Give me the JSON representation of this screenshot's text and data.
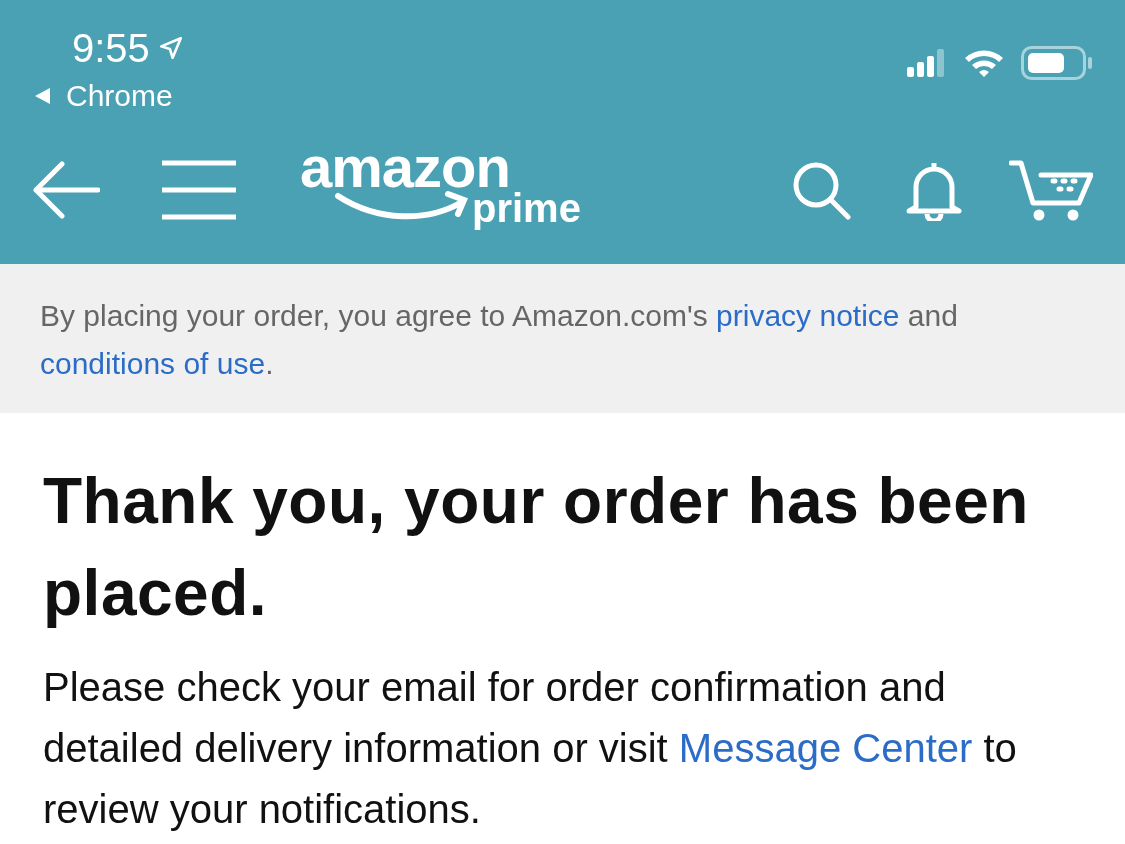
{
  "status_bar": {
    "time": "9:55",
    "back_app": "Chrome"
  },
  "header": {
    "logo_main": "amazon",
    "logo_sub": "prime"
  },
  "notice": [
    {
      "kind": "text",
      "text": "By placing your order, you agree to Amazon.com's "
    },
    {
      "kind": "link",
      "text": "privacy notice"
    },
    {
      "kind": "text",
      "text": " and "
    },
    {
      "kind": "link",
      "text": "conditions of use"
    },
    {
      "kind": "text",
      "text": "."
    }
  ],
  "heading": "Thank you, your order has been placed.",
  "message": [
    {
      "kind": "text",
      "text": "Please check your email for order confirmation and detailed delivery information or visit "
    },
    {
      "kind": "link",
      "text": "Message Center"
    },
    {
      "kind": "text",
      "text": " to review your notifications."
    }
  ]
}
